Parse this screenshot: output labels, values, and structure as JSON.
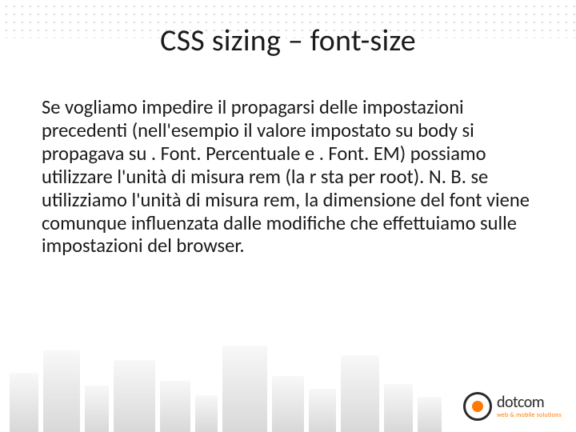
{
  "slide": {
    "title": "CSS sizing – font-size",
    "body": "Se vogliamo impedire il propagarsi delle impostazioni precedenti (nell'esempio il valore impostato su body si propagava su . Font. Percentuale e . Font. EM) possiamo utilizzare l'unità di misura rem (la r sta per root). N. B. se utilizziamo l'unità di misura rem, la dimensione del font viene comunque influenzata dalle modifiche che effettuiamo sulle impostazioni del browser."
  },
  "logo": {
    "name": "dotcom",
    "tagline": "web & mobile solutions"
  }
}
